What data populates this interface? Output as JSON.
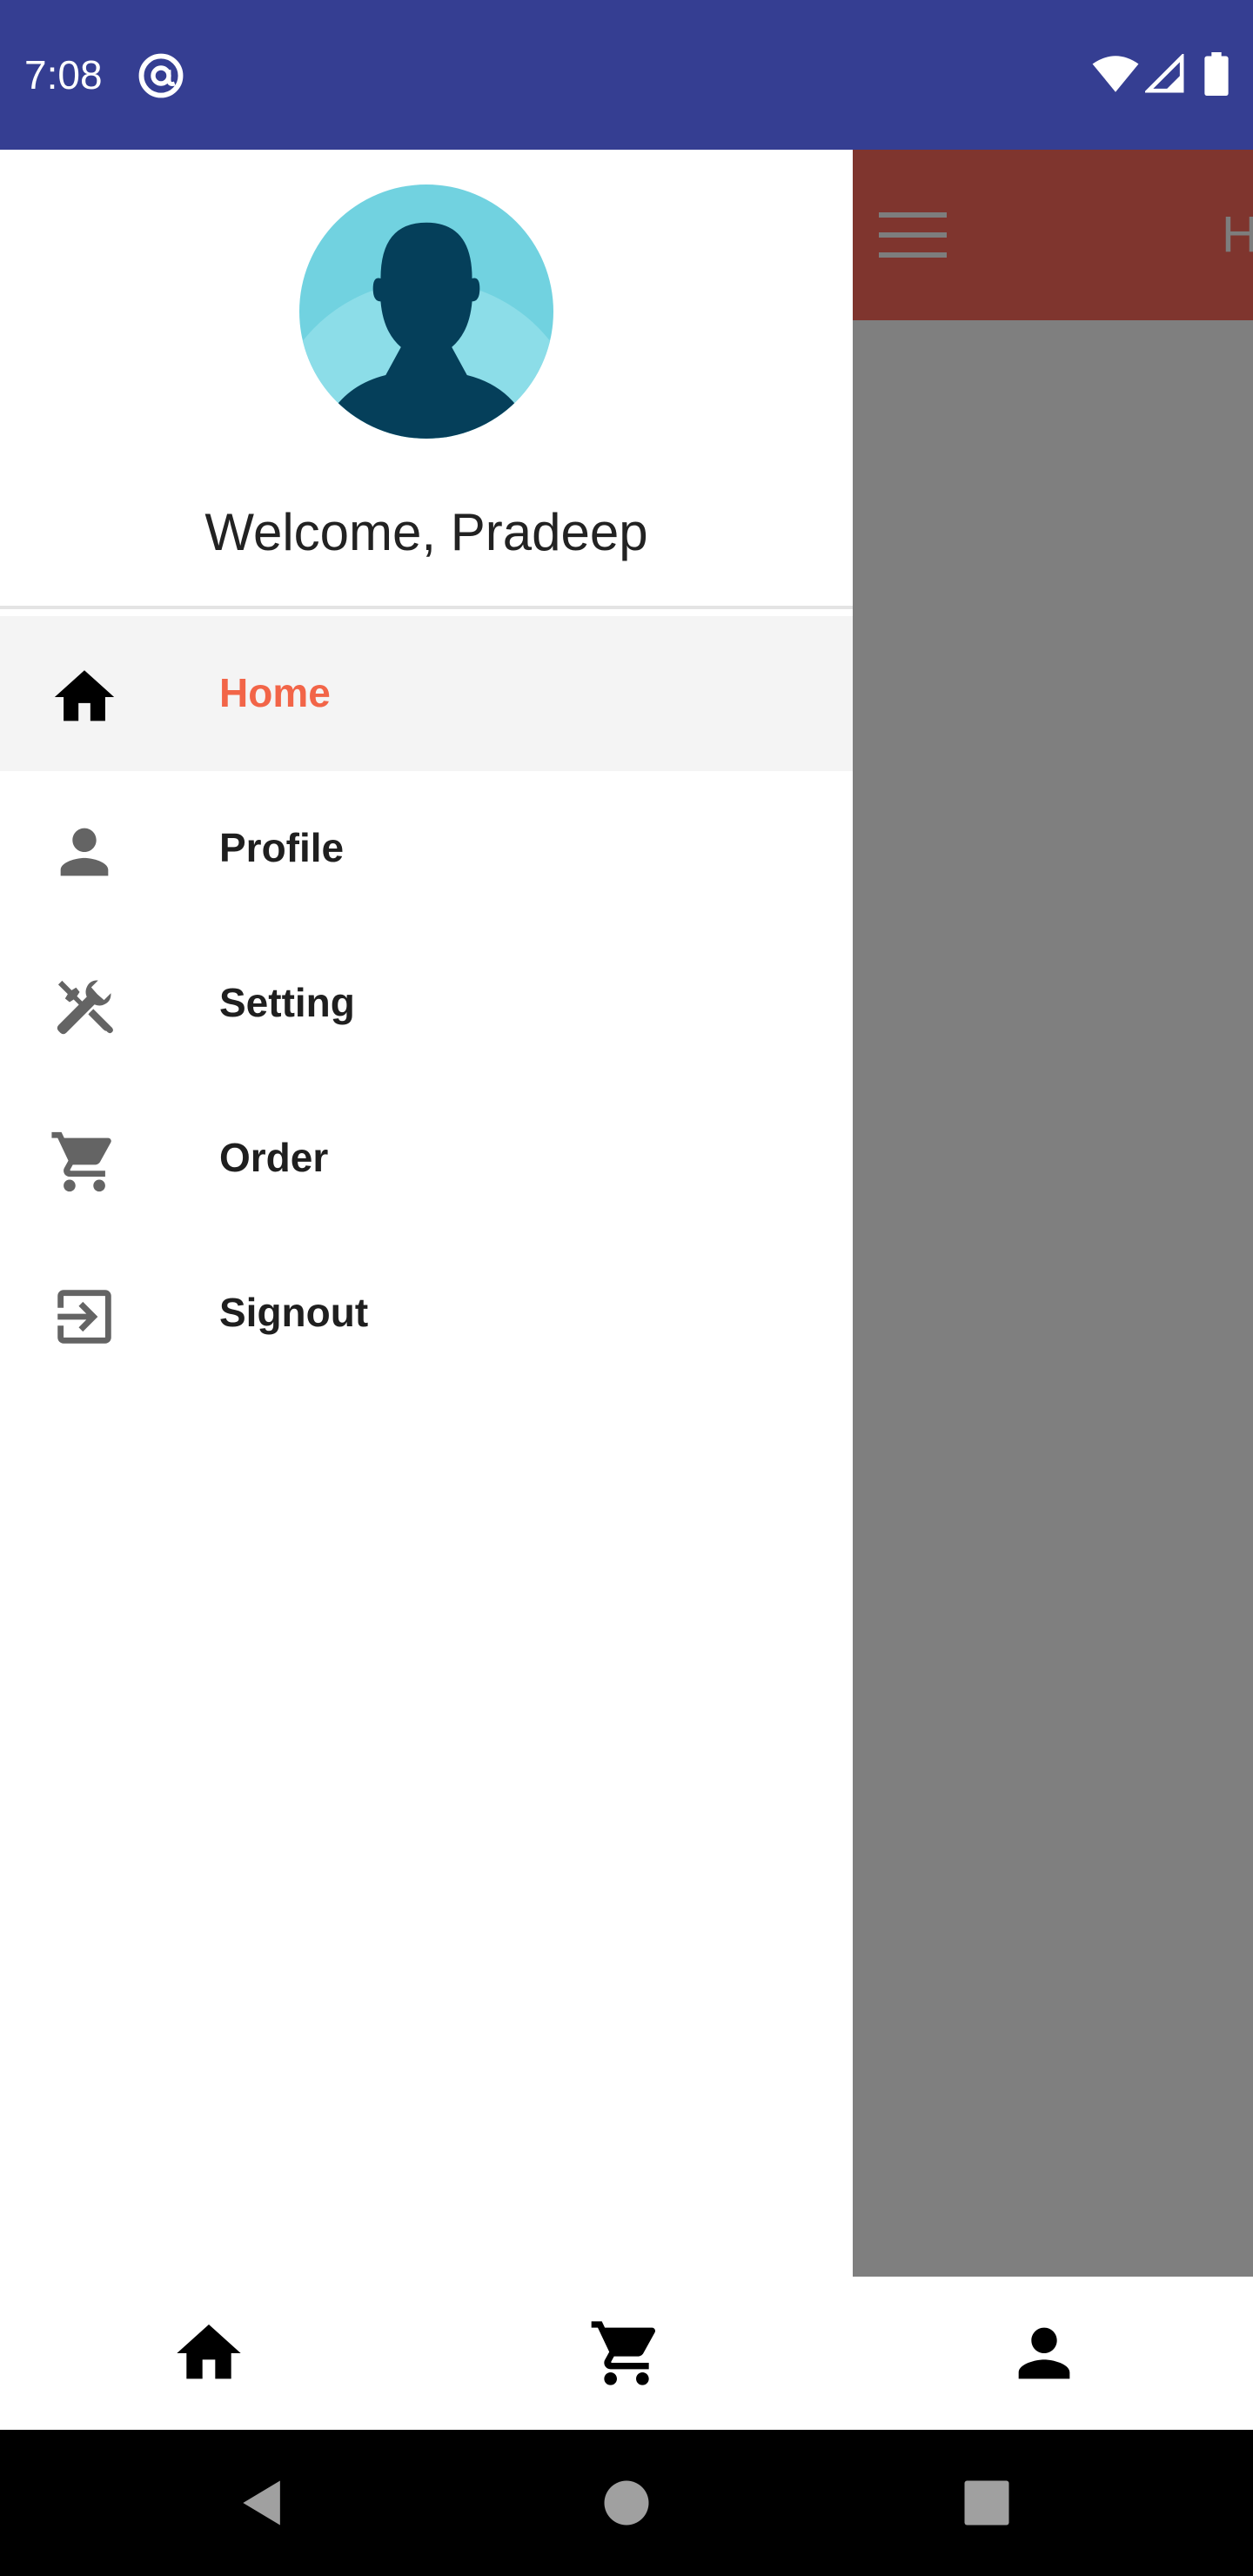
{
  "status_bar": {
    "time": "7:08",
    "background": "#353e92",
    "icons": [
      "at-sign-icon",
      "wifi-icon",
      "cell-signal-icon",
      "battery-icon"
    ]
  },
  "app_toolbar": {
    "title": "H",
    "background": "#7f352e",
    "icon": "hamburger-menu-icon"
  },
  "drawer": {
    "welcome_text": "Welcome, Pradeep",
    "avatar_icon": "user-avatar-icon",
    "items": [
      {
        "label": "Home",
        "icon": "home-icon",
        "active": true
      },
      {
        "label": "Profile",
        "icon": "person-icon",
        "active": false
      },
      {
        "label": "Setting",
        "icon": "tools-icon",
        "active": false
      },
      {
        "label": "Order",
        "icon": "cart-icon",
        "active": false
      },
      {
        "label": "Signout",
        "icon": "exit-icon",
        "active": false
      }
    ],
    "active_color": "#f26548"
  },
  "bottom_nav": {
    "items": [
      "home-icon",
      "cart-icon",
      "person-icon"
    ]
  },
  "system_nav": {
    "buttons": [
      "back-icon",
      "home-circle-icon",
      "recents-icon"
    ]
  }
}
